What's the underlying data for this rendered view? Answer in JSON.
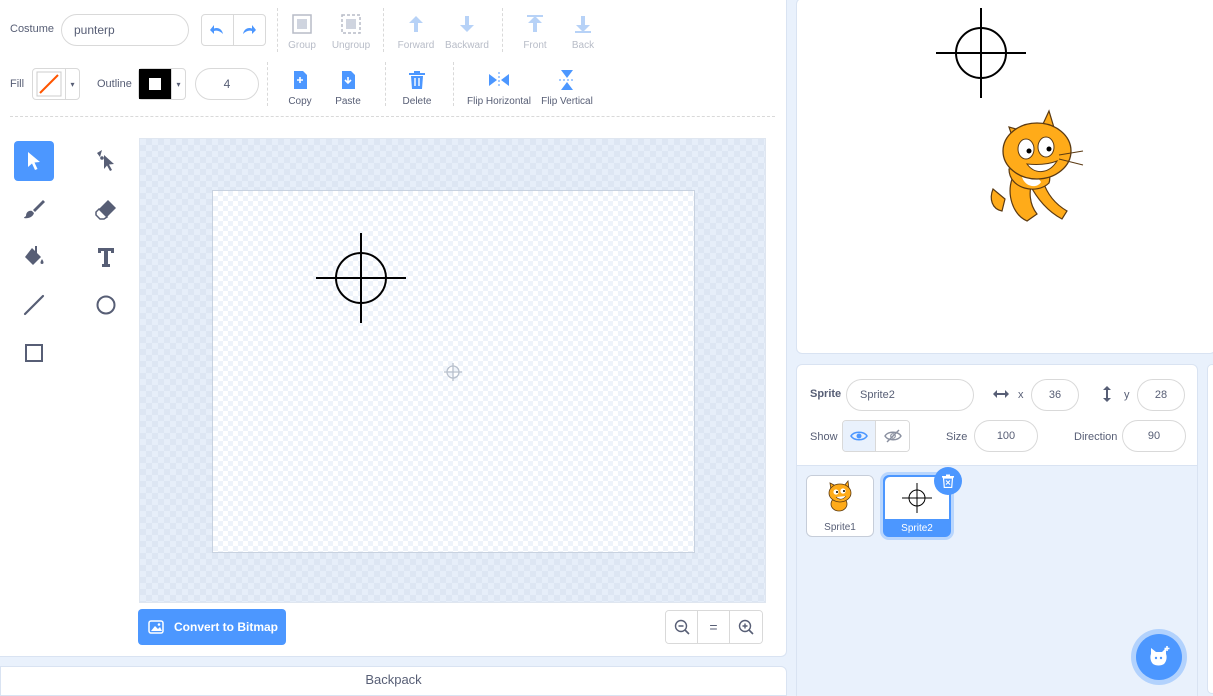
{
  "costume": {
    "label": "Costume",
    "name": "punterp"
  },
  "toolbar": {
    "group": "Group",
    "ungroup": "Ungroup",
    "forward": "Forward",
    "backward": "Backward",
    "front": "Front",
    "back": "Back",
    "copy": "Copy",
    "paste": "Paste",
    "delete": "Delete",
    "flip_h": "Flip Horizontal",
    "flip_v": "Flip Vertical"
  },
  "fill": {
    "label": "Fill",
    "color": "#ff5500"
  },
  "outline": {
    "label": "Outline",
    "color": "#000000",
    "width": "4"
  },
  "tools": [
    "select-tool",
    "reshape-tool",
    "brush-tool",
    "eraser-tool",
    "fill-tool",
    "text-tool",
    "line-tool",
    "circle-tool",
    "rectangle-tool"
  ],
  "convert": {
    "label": "Convert to Bitmap"
  },
  "zoom": {
    "out": "zoom-out-icon",
    "reset": "=",
    "in": "zoom-in-icon"
  },
  "backpack": {
    "label": "Backpack"
  },
  "sprite": {
    "label": "Sprite",
    "name": "Sprite2",
    "x_label": "x",
    "x": "36",
    "y_label": "y",
    "y": "28",
    "show_label": "Show",
    "size_label": "Size",
    "size": "100",
    "direction_label": "Direction",
    "direction": "90"
  },
  "sprites": [
    {
      "name": "Sprite1",
      "selected": false
    },
    {
      "name": "Sprite2",
      "selected": true
    }
  ],
  "colors": {
    "accent": "#4c97ff",
    "text": "#575e75",
    "cat_orange": "#ffab19"
  }
}
